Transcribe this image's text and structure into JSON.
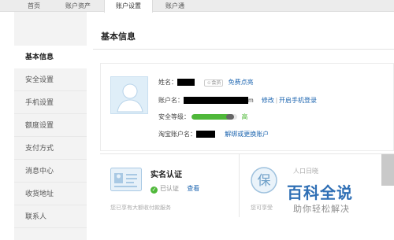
{
  "topnav": {
    "tabs": [
      {
        "label": "首页"
      },
      {
        "label": "账户资产"
      },
      {
        "label": "账户设置",
        "active": true
      },
      {
        "label": "账户通"
      }
    ]
  },
  "sidebar": {
    "items": [
      {
        "label": "基本信息",
        "active": true
      },
      {
        "label": "安全设置"
      },
      {
        "label": "手机设置"
      },
      {
        "label": "额度设置"
      },
      {
        "label": "支付方式"
      },
      {
        "label": "消息中心"
      },
      {
        "label": "收货地址"
      },
      {
        "label": "联系人"
      }
    ]
  },
  "main": {
    "title": "基本信息",
    "profile": {
      "name_label": "姓名：",
      "member_badge": "会员",
      "free_light_link": "免费点亮",
      "account_label": "账户名：",
      "account_suffix": "m",
      "modify_link": "修改",
      "separator": "|",
      "mobile_login_link": "开启手机登录",
      "security_label": "安全等级：",
      "security_level_text": "高",
      "security_level_fraction": 0.85,
      "taobao_label": "淘宝账户名：",
      "unbind_link": "解绑或更换账户"
    },
    "realname": {
      "title": "实名认证",
      "status": "已认证",
      "check_mark": "✓",
      "view_link": "查看",
      "desc": "您已享有大额收付款服务"
    },
    "insurance": {
      "icon_char": "保",
      "title": "人口日晓",
      "desc": "您可享受"
    }
  },
  "watermark": {
    "main": "百科全说",
    "sub": "助你轻松解决"
  },
  "colors": {
    "link": "#1e66b0",
    "green": "#4fb83a",
    "watermark_blue": "#2f6fb5"
  }
}
